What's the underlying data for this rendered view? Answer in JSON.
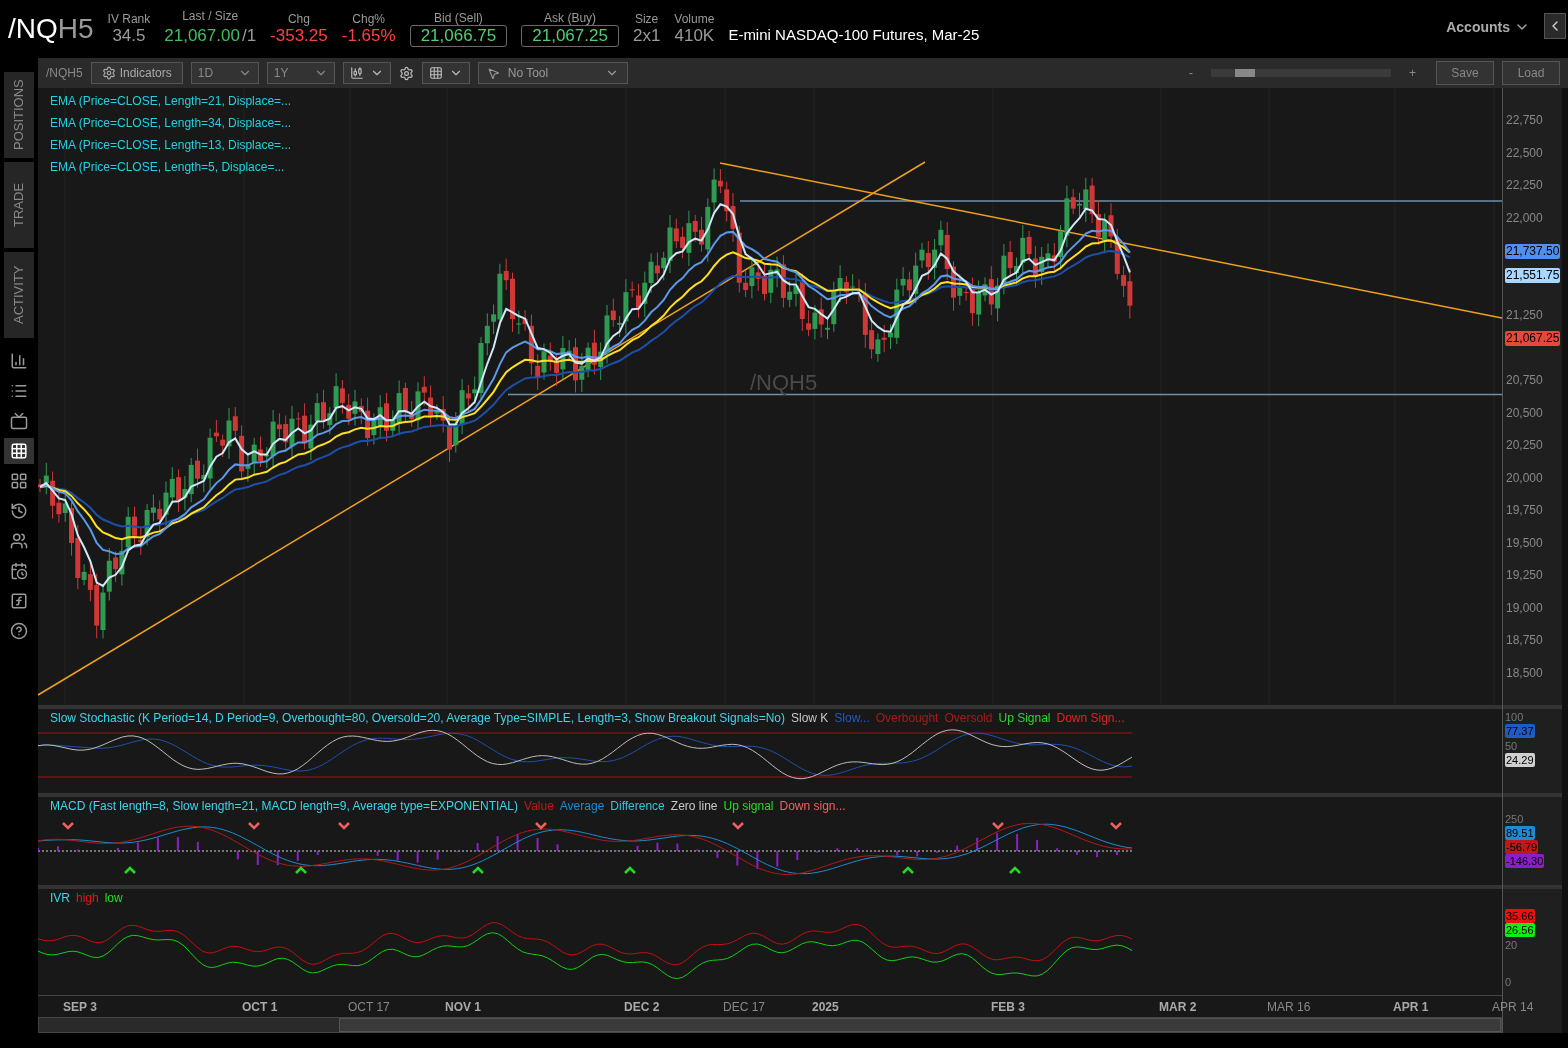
{
  "quote": {
    "symbol_root": "/NQ",
    "symbol_suffix": "H5",
    "fields": [
      {
        "label": "IV Rank",
        "value": "34.5",
        "color": "#9a9a9a",
        "boxed": false
      },
      {
        "label": "Last / Size",
        "value": "21,067.00",
        "extra": "/1",
        "color": "#3fbf5f",
        "boxed": false
      },
      {
        "label": "Chg",
        "value": "-353.25",
        "color": "#ff4040",
        "boxed": false
      },
      {
        "label": "Chg%",
        "value": "-1.65%",
        "color": "#ff4040",
        "boxed": false
      },
      {
        "label": "Bid (Sell)",
        "value": "21,066.75",
        "color": "#4fcf6f",
        "boxed": true
      },
      {
        "label": "Ask (Buy)",
        "value": "21,067.25",
        "color": "#4fcf6f",
        "boxed": true
      },
      {
        "label": "Size",
        "value": "2x1",
        "color": "#9a9a9a",
        "boxed": false
      },
      {
        "label": "Volume",
        "value": "410K",
        "color": "#9a9a9a",
        "boxed": false
      }
    ],
    "description": "E-mini NASDAQ-100 Futures, Mar-25",
    "accounts": "Accounts"
  },
  "sidebar": {
    "tabs": [
      {
        "label": "POSITIONS"
      },
      {
        "label": "TRADE"
      },
      {
        "label": "ACTIVITY"
      }
    ],
    "tools": [
      {
        "selected": false
      },
      {
        "selected": false
      },
      {
        "selected": false
      },
      {
        "selected": true
      },
      {
        "selected": false
      },
      {
        "selected": false
      },
      {
        "selected": false
      },
      {
        "selected": false
      },
      {
        "selected": false
      },
      {
        "selected": false
      }
    ]
  },
  "toolbar": {
    "symbol": "/NQH5",
    "indicators": "Indicators",
    "aggregation": "1D",
    "period": "1Y",
    "tool": "No Tool",
    "zoom_minus": "-",
    "zoom_plus": "+",
    "zoom": {
      "level": 0.15
    },
    "save": "Save",
    "load": "Load"
  },
  "studies": [
    "EMA (Price=CLOSE, Length=21, Displace=...",
    "EMA (Price=CLOSE, Length=34, Displace=...",
    "EMA (Price=CLOSE, Length=13, Displace=...",
    "EMA (Price=CLOSE, Length=5, Displace=..."
  ],
  "watermark": "/NQH5",
  "price_chart": {
    "price_axis": [
      "22,750",
      "22,500",
      "22,250",
      "22,000",
      "21,250",
      "20,750",
      "20,500",
      "20,250",
      "20,000",
      "19,750",
      "19,500",
      "19,250",
      "19,000",
      "18,750",
      "18,500"
    ],
    "date_axis": [
      {
        "label": "SEP 3",
        "major": true
      },
      {
        "label": "OCT 1",
        "major": true
      },
      {
        "label": "OCT 17",
        "major": false
      },
      {
        "label": "NOV 1",
        "major": true
      },
      {
        "label": "DEC 2",
        "major": true
      },
      {
        "label": "DEC 17",
        "major": false
      },
      {
        "label": "2025",
        "major": true
      },
      {
        "label": "FEB 3",
        "major": true
      },
      {
        "label": "MAR 2",
        "major": true
      },
      {
        "label": "MAR 16",
        "major": false
      },
      {
        "label": "APR 1",
        "major": true
      },
      {
        "label": "APR 14",
        "major": false
      }
    ],
    "markers": [
      {
        "label": "21,737.50",
        "color": "#4f8ff0"
      },
      {
        "label": "21,551.75",
        "color": "#a8d8ff"
      },
      {
        "label": "21,067.25",
        "color": "#e8483c"
      }
    ]
  },
  "stochastic": {
    "title": "Slow Stochastic (K Period=14, D Period=9, Overbought=80, Oversold=20, Average Type=SIMPLE, Length=3, Show Breakout Signals=No)",
    "legend": [
      {
        "label": "Slow K",
        "color": "#c8c8c8"
      },
      {
        "label": "Slow...",
        "color": "#2456c8"
      },
      {
        "label": "Overbought",
        "color": "#b01818"
      },
      {
        "label": "Oversold",
        "color": "#b01818"
      },
      {
        "label": "Up Signal",
        "color": "#22dd22"
      },
      {
        "label": "Down Sign...",
        "color": "#e82020"
      }
    ],
    "ticks": [
      "100",
      "50"
    ],
    "badges": [
      {
        "label": "77.37",
        "color": "#1e5bc8"
      },
      {
        "label": "24.29",
        "color": "#d0d0d0"
      }
    ]
  },
  "macd": {
    "title": "MACD (Fast length=8, Slow length=21, MACD length=9, Average type=EXPONENTIAL)",
    "legend": [
      {
        "label": "Value",
        "color": "#c01818"
      },
      {
        "label": "Average",
        "color": "#1e8ad0"
      },
      {
        "label": "Difference",
        "color": "#30c8d8"
      },
      {
        "label": "Zero line",
        "color": "#c8c8c8"
      },
      {
        "label": "Up signal",
        "color": "#22dd22"
      },
      {
        "label": "Down sign...",
        "color": "#f06060"
      }
    ],
    "ticks": [
      "250"
    ],
    "badges": [
      {
        "label": "89.51",
        "color": "#1e8ad0"
      },
      {
        "label": "-56.79",
        "color": "#c01818"
      },
      {
        "label": "-146.30",
        "color": "#8a1ec8"
      }
    ]
  },
  "ivr": {
    "title": "IVR",
    "legend": [
      {
        "label": "high",
        "color": "#e01818"
      },
      {
        "label": "low",
        "color": "#22dd22"
      }
    ],
    "ticks": [
      "20",
      "0"
    ],
    "badges": [
      {
        "label": "35.66",
        "color": "#ee1010"
      },
      {
        "label": "26.56",
        "color": "#10ee10"
      }
    ]
  }
}
